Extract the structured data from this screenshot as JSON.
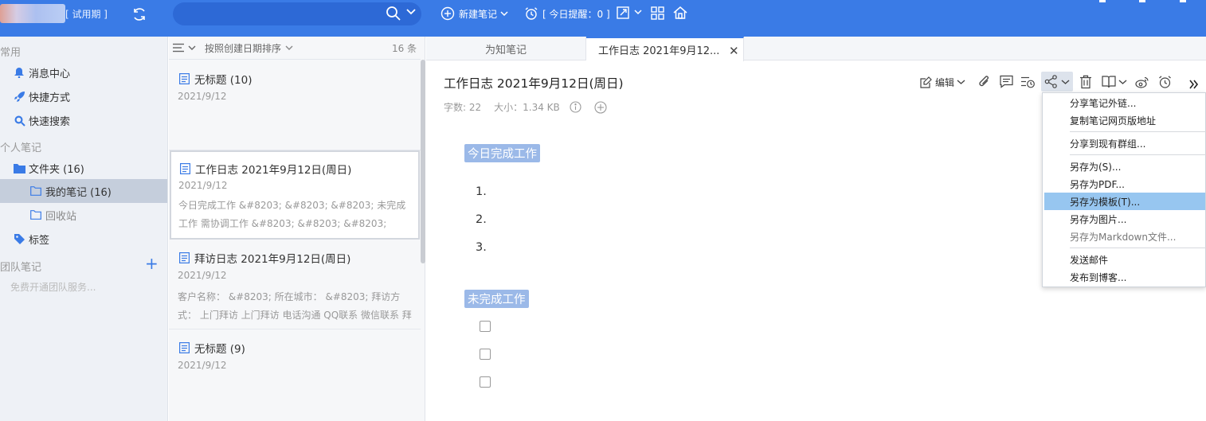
{
  "topbar": {
    "trial": "[ 试用期 ]",
    "new_note": "新建笔记",
    "reminder": "[ 今日提醒：0 ]"
  },
  "sidebar": {
    "common_title": "常用",
    "common_items": [
      "消息中心",
      "快捷方式",
      "快速搜索"
    ],
    "personal_title": "个人笔记",
    "folder": "文件夹 (16)",
    "my_notes": "我的笔记 (16)",
    "recycle": "回收站",
    "tags": "标签",
    "team_title": "团队笔记",
    "team_free": "免费开通团队服务..."
  },
  "notelist": {
    "sort_label": "按照创建日期排序",
    "count": "16 条",
    "notes": [
      {
        "title": "无标题 (10)",
        "date": "2021/9/12",
        "preview": ""
      },
      {
        "title": "工作日志 2021年9月12日(周日)",
        "date": "2021/9/12",
        "preview": "今日完成工作 &#8203; &#8203; &#8203; 未完成工作 需协调工作 &#8203; &#8203; &#8203;"
      },
      {
        "title": "拜访日志 2021年9月12日(周日)",
        "date": "2021/9/12",
        "preview": "客户名称：  &#8203; 所在城市：  &#8203; 拜访方式：  上门拜访 上门拜访 电话沟通 QQ联系 微信联系 拜访..."
      },
      {
        "title": "无标题 (9)",
        "date": "2021/9/12",
        "preview": ""
      }
    ]
  },
  "editor": {
    "tabs": [
      "为知笔记",
      "工作日志 2021年9月12..."
    ],
    "title": "工作日志 2021年9月12日(周日)",
    "word_count": "字数: 22",
    "size": "大小：1.34 KB",
    "edit_label": "编辑",
    "section1": "今日完成工作",
    "list": [
      "1.",
      "2.",
      "3."
    ],
    "section2": "未完成工作"
  },
  "share_menu": {
    "items": [
      "分享笔记外链...",
      "复制笔记网页版地址",
      "分享到现有群组...",
      "另存为(S)...",
      "另存为PDF...",
      "另存为模板(T)...",
      "另存为图片...",
      "另存为Markdown文件...",
      "发送邮件",
      "发布到博客..."
    ],
    "active_index": 5
  },
  "colors": {
    "topbar": "#3a7be6",
    "sidebar": "#eef1f6",
    "selected_folder": "#c5cedc",
    "heading_highlight": "#9bb9e8",
    "menu_active": "#97c6f0"
  }
}
